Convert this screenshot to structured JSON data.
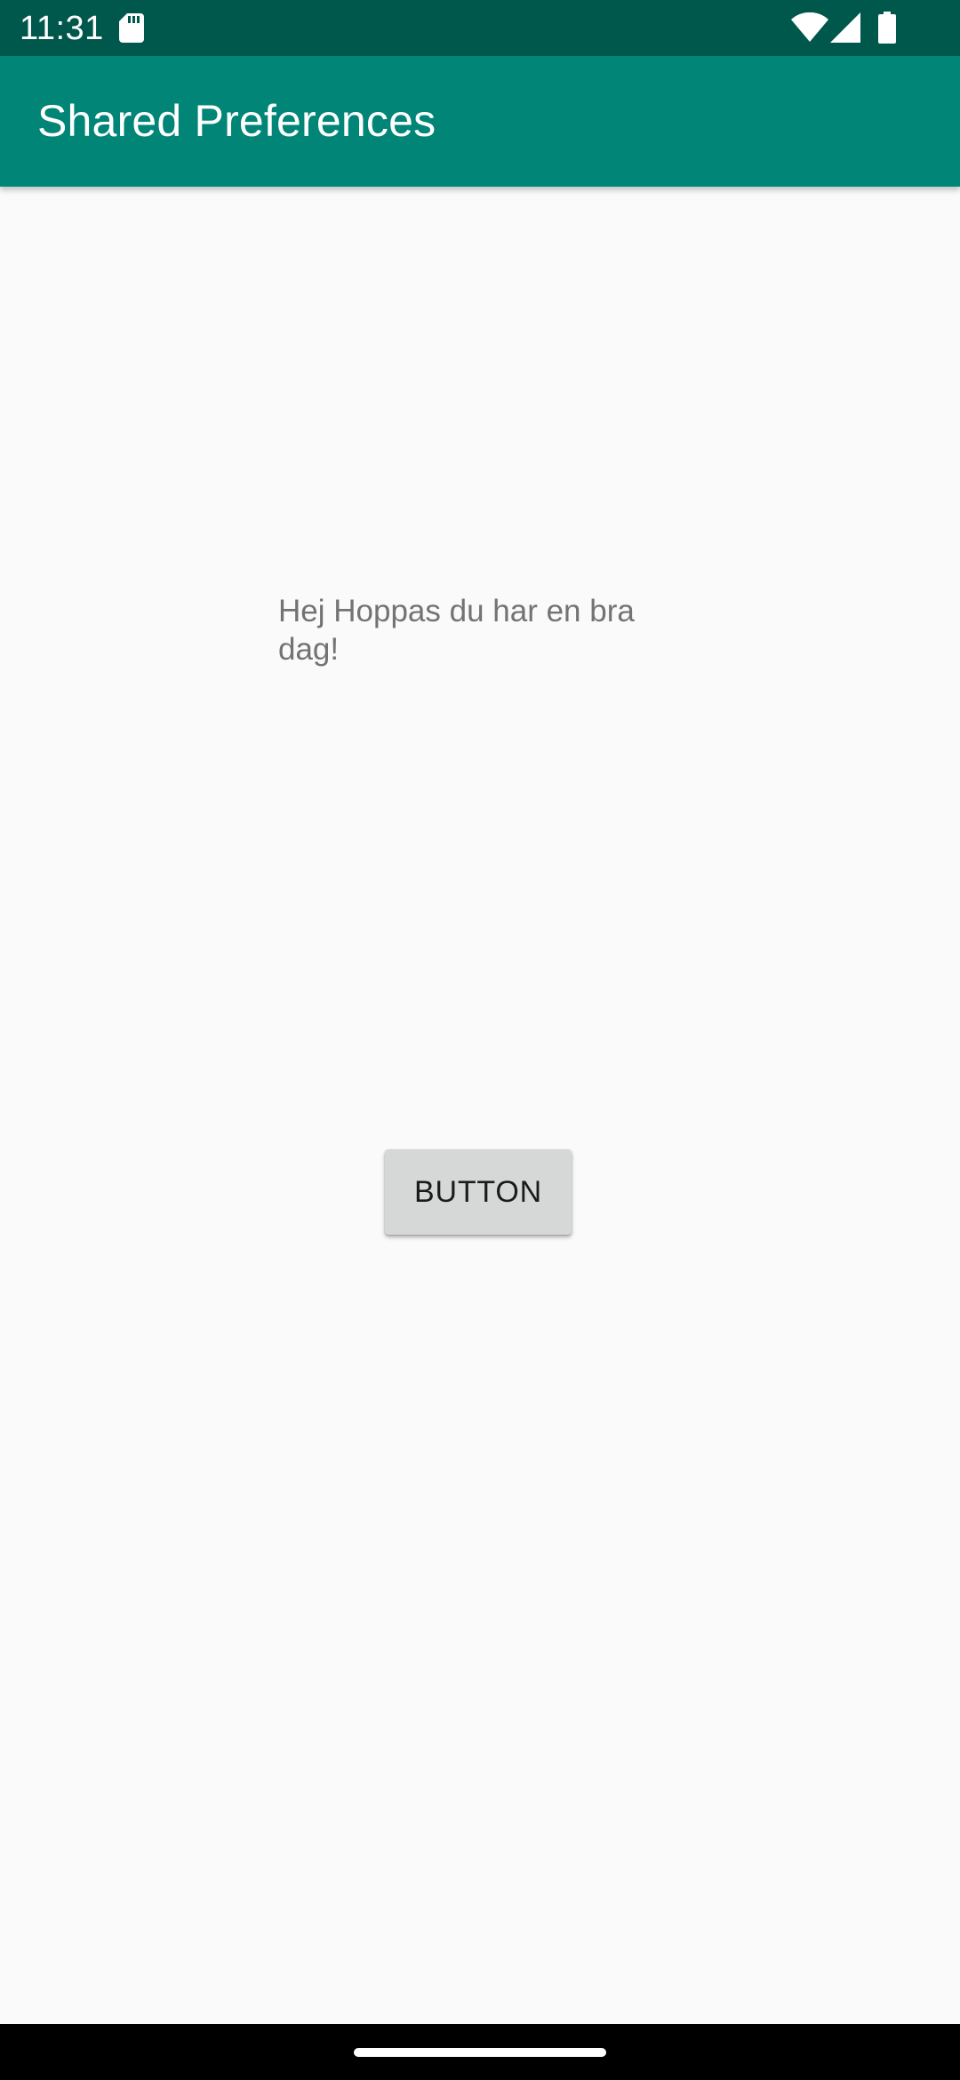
{
  "status_bar": {
    "time": "11:31",
    "icons": [
      "sd-card-icon",
      "wifi-icon",
      "signal-icon",
      "battery-icon"
    ]
  },
  "app_bar": {
    "title": "Shared Preferences"
  },
  "content": {
    "message": "Hej Hoppas du har en bra dag!",
    "button_label": "BUTTON"
  },
  "colors": {
    "status_bar": "#00574b",
    "app_bar": "#008577",
    "background": "#fafafa",
    "button": "#d6d7d7",
    "message_text": "#737373"
  }
}
